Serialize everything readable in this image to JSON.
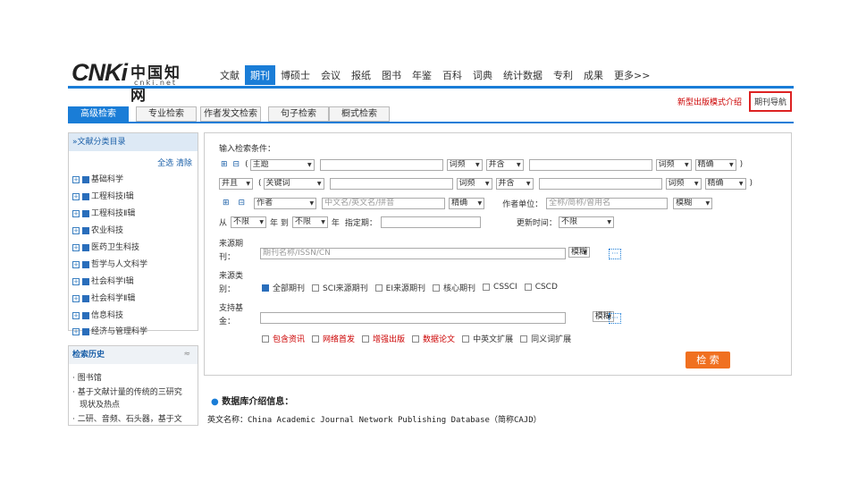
{
  "logo": {
    "mark": "CNKi",
    "cn": "中国知网",
    "domain": "cnki.net"
  },
  "topnav": [
    "文献",
    "期刊",
    "博硕士",
    "会议",
    "报纸",
    "图书",
    "年鉴",
    "百科",
    "词典",
    "统计数据",
    "专利",
    "成果",
    "更多>>"
  ],
  "toplinks": {
    "new": "新型出版模式介绍",
    "nav": "期刊导航"
  },
  "tabs": [
    "高级检索",
    "专业检索",
    "作者发文检索",
    "句子检索",
    "橱式检索"
  ],
  "left": {
    "title": "»文献分类目录",
    "select_all": "全选",
    "clear": "清除",
    "items": [
      "基础科学",
      "工程科技Ⅰ辑",
      "工程科技Ⅱ辑",
      "农业科技",
      "医药卫生科技",
      "哲学与人文科学",
      "社会科学Ⅰ辑",
      "社会科学Ⅱ辑",
      "信息科技",
      "经济与管理科学"
    ]
  },
  "history": {
    "title": "检索历史",
    "toggle": "≈",
    "items": [
      "图书馆",
      "基于文献计量的传统的三研究",
      "现状及热点",
      "二研、音频、石头器，基于文"
    ]
  },
  "form": {
    "cond_label": "输入检索条件：",
    "row1": {
      "toggle1": "⊞",
      "toggle2": "⊟",
      "paren_open": "(",
      "field": "主题",
      "freq": "词频",
      "op": "并含",
      "freq2": "词频",
      "match": "精确",
      "paren_close": ")"
    },
    "row2": {
      "logic": "并且",
      "paren_open": "(",
      "field": "关键词",
      "freq": "词频",
      "op": "并含",
      "freq2": "词频",
      "match": "精确",
      "paren_close": ")"
    },
    "row3": {
      "plus": "⊞",
      "minus": "⊟",
      "field": "作者",
      "placeholder": "中文名/英文名/拼音",
      "match": "精确",
      "org_label": "作者单位：",
      "org_placeholder": "全称/简称/曾用名",
      "org_match": "模糊"
    },
    "row4": {
      "from": "从",
      "from_val": "不限",
      "year1": "年 到",
      "to_val": "不限",
      "year2": "年",
      "date_label": "指定期：",
      "update_label": "更新时间：",
      "update_val": "不限"
    },
    "source": {
      "label1": "来源期",
      "label2": "刊：",
      "placeholder": "期刊名称/ISSN/CN",
      "match": "模糊",
      "more": "···"
    },
    "category": {
      "label1": "来源类",
      "label2": "别：",
      "items": [
        {
          "label": "全部期刊",
          "on": true
        },
        {
          "label": "SCI来源期刊",
          "on": false
        },
        {
          "label": "EI来源期刊",
          "on": false
        },
        {
          "label": "核心期刊",
          "on": false
        },
        {
          "label": "CSSCI",
          "on": false
        },
        {
          "label": "CSCD",
          "on": false
        }
      ]
    },
    "fund": {
      "label1": "支持基",
      "label2": "金：",
      "match": "模糊",
      "more": "···"
    },
    "options": [
      {
        "label": "包含资讯",
        "red": true
      },
      {
        "label": "网络首发",
        "red": true
      },
      {
        "label": "增强出版",
        "red": true
      },
      {
        "label": "数据论文",
        "red": true
      },
      {
        "label": "中英文扩展",
        "red": false
      },
      {
        "label": "同义词扩展",
        "red": false
      }
    ],
    "search_btn": "检 索"
  },
  "info": {
    "title": "数据库介绍信息：",
    "eng_label": "英文名称：",
    "eng_value": "China Academic Journal Network Publishing Database（简称CAJD）"
  }
}
